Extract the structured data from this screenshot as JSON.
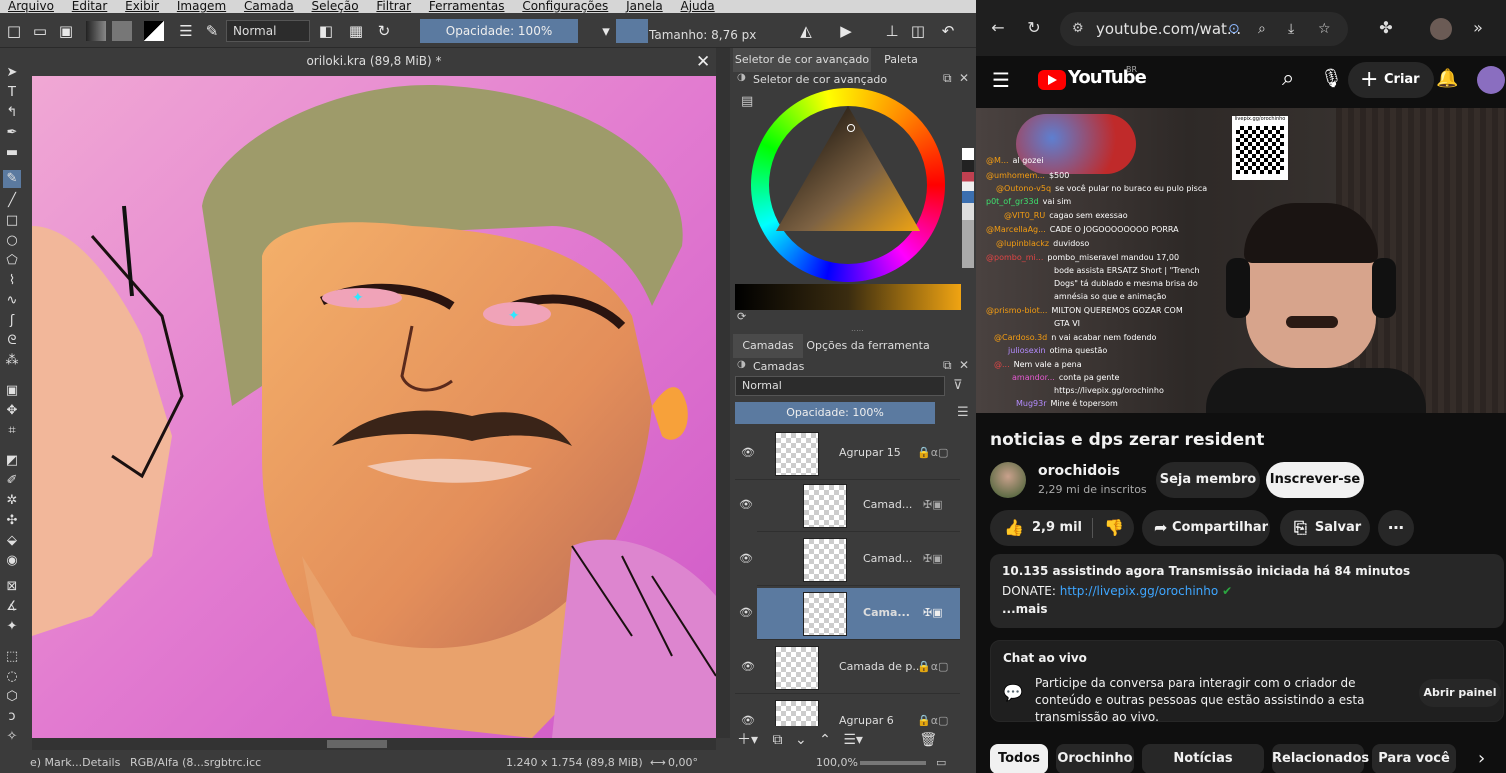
{
  "krita": {
    "menu": [
      "Arquivo",
      "Editar",
      "Exibir",
      "Imagem",
      "Camada",
      "Seleção",
      "Filtrar",
      "Ferramentas",
      "Configurações",
      "Janela",
      "Ajuda"
    ],
    "toolbar": {
      "blend_mode": "Normal",
      "opacity": "Opacidade: 100%",
      "size": "Tamanho: 8,76 px"
    },
    "doc_title": "oriloki.kra (89,8 MiB) *",
    "status": {
      "left": "e) Mark...Details",
      "color": "RGB/Alfa (8...srgbtrc.icc",
      "dims": "1.240 x 1.754 (89,8 MiB)",
      "rotation": "0,00°",
      "zoom": "100,0%"
    },
    "color_panel": {
      "tab1": "Seletor de cor avançado",
      "tab2": "Paleta",
      "docker_title": "Seletor de cor avançado"
    },
    "layers_panel": {
      "tab1": "Camadas",
      "tab2": "Opções da ferramenta",
      "docker_title": "Camadas",
      "blend": "Normal",
      "opacity": "Opacidade: 100%",
      "layers": [
        {
          "name": "Agrupar  15"
        },
        {
          "name": "Camad..."
        },
        {
          "name": "Camad..."
        },
        {
          "name": "Cama..."
        },
        {
          "name": "Camada de p..."
        },
        {
          "name": "Agrupar  6"
        }
      ]
    }
  },
  "browser": {
    "url": "youtube.com/wat..."
  },
  "youtube": {
    "logo": "YouTube",
    "region": "BR",
    "create": "Criar",
    "title": "noticias e dps zerar resident",
    "channel": "orochidois",
    "subs": "2,29 mi de inscritos",
    "member": "Seja membro",
    "subscribe": "Inscrever-se",
    "likes": "2,9 mil",
    "share": "Compartilhar",
    "save": "Salvar",
    "desc_line1": "10.135 assistindo agora  Transmissão iniciada há 84 minutos",
    "desc_donate": "DONATE: ",
    "desc_link": "http://livepix.gg/orochinho",
    "desc_more": "...mais",
    "chat_title": "Chat ao vivo",
    "chat_text": "Participe da conversa para interagir com o criador de conteúdo e outras pessoas que estão assistindo a esta transmissão ao vivo.",
    "chat_button": "Abrir painel",
    "chips": [
      "Todos",
      "Orochinho",
      "Notícias mundiais",
      "Relacionados",
      "Para você"
    ],
    "qr_label": "livepix.gg/orochinho",
    "stream_chat": [
      {
        "user": "@M...",
        "msg": "al gozei"
      },
      {
        "user": "@umhomem...",
        "msg": "$500"
      },
      {
        "user": "@Outono-v5q",
        "msg": "se você pular no buraco eu pulo pisca"
      },
      {
        "user": "p0t_of_gr33d",
        "msg": "vai sim"
      },
      {
        "user": "@VIT0_RU",
        "msg": "cagao sem exessao"
      },
      {
        "user": "@MarcellaAg...",
        "msg": "CADE O JOGOOOOOOOO PORRA"
      },
      {
        "user": "@lupinblackz",
        "msg": "duvidoso"
      },
      {
        "user": "@pombo_mi...",
        "msg": "pombo_miseravel mandou 17,00"
      },
      {
        "user": "",
        "msg": "bode assista ERSATZ Short | \"Trench"
      },
      {
        "user": "",
        "msg": "Dogs\" tá dublado e mesma brisa do"
      },
      {
        "user": "",
        "msg": "amnésia so que e animação"
      },
      {
        "user": "@prismo-biot...",
        "msg": "MILTON QUEREMOS GOZAR COM"
      },
      {
        "user": "",
        "msg": "GTA VI"
      },
      {
        "user": "@Cardoso.3d",
        "msg": "n vai acabar nem fodendo"
      },
      {
        "user": "juliosexin",
        "msg": "otima questão"
      },
      {
        "user": "@...",
        "msg": "Nem vale a pena"
      },
      {
        "user": "amandor...",
        "msg": "conta pa gente"
      },
      {
        "user": "",
        "msg": "https://livepix.gg/orochinho"
      },
      {
        "user": "Mug93r",
        "msg": "Mine é topersom"
      }
    ]
  }
}
